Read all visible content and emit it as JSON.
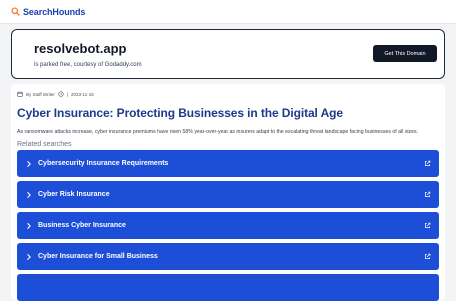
{
  "header": {
    "brand": "SearchHounds",
    "brand_icon": "search-icon",
    "brand_color": "#1e40af"
  },
  "parked": {
    "domain": "resolvebot.app",
    "subtitle": "is parked free, courtesy of Godaddy.com",
    "button_label": "Get This Domain"
  },
  "article": {
    "author": "By Staff Writer",
    "separator": "|",
    "date": "2023-11-15",
    "title": "Cyber Insurance: Protecting Businesses in the Digital Age",
    "description": "As ransomware attacks increase, cyber insurance premiums have risen 58% year-over-year as insurers adapt to the escalating threat landscape facing businesses of all sizes.",
    "related_label": "Related searches"
  },
  "related_searches": [
    {
      "label": "Cybersecurity Insurance Requirements"
    },
    {
      "label": "Cyber Risk Insurance"
    },
    {
      "label": "Business Cyber Insurance"
    },
    {
      "label": "Cyber Insurance for Small Business"
    },
    {
      "label": ""
    }
  ],
  "colors": {
    "accent": "#1d4ed8",
    "title": "#1e3a8a",
    "button": "#111827"
  }
}
